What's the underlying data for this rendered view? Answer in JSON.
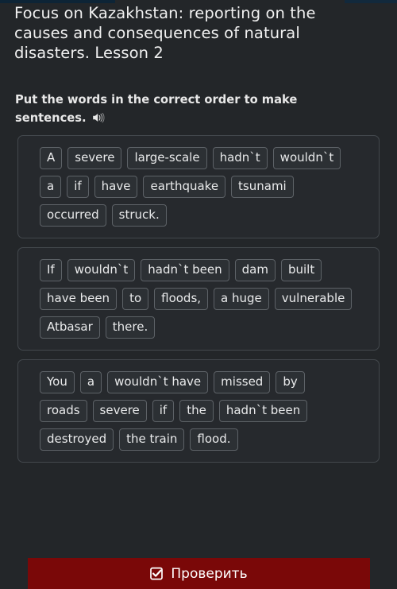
{
  "lesson": {
    "title": "Focus on Kazakhstan: reporting on the causes and consequences of natural disasters. Lesson 2"
  },
  "instruction": {
    "text": "Put the words in the correct order to make sentences.",
    "audio_icon": "speaker-icon"
  },
  "exercise": {
    "groups": [
      {
        "rows": [
          [
            "A",
            "severe",
            "large-scale",
            "hadn`t",
            "wouldn`t"
          ],
          [
            "a",
            "if",
            "have",
            "earthquake",
            "tsunami"
          ],
          [
            "occurred",
            "struck."
          ]
        ]
      },
      {
        "rows": [
          [
            "If",
            "wouldn`t",
            "hadn`t been",
            "dam",
            "built"
          ],
          [
            "have been",
            "to",
            "floods,",
            "a huge",
            "vulnerable"
          ],
          [
            "Atbasar",
            "there."
          ]
        ]
      },
      {
        "rows": [
          [
            "You",
            "a",
            "wouldn`t have",
            "missed",
            "by"
          ],
          [
            "roads",
            "severe",
            "if",
            "the",
            "hadn`t been"
          ],
          [
            "destroyed",
            "the train",
            "flood."
          ]
        ]
      }
    ]
  },
  "footer": {
    "check_label": "Проверить",
    "check_icon": "checked-checkbox-icon"
  },
  "colors": {
    "background": "#232629",
    "group_background": "#26292d",
    "group_border": "#43484d",
    "chip_background": "#2c3034",
    "chip_border": "#5d6267",
    "text": "#e9eaeb",
    "button_red": "#7a0808",
    "button_red_dark": "#5b0606",
    "top_strip_navy": "#0d2436"
  }
}
